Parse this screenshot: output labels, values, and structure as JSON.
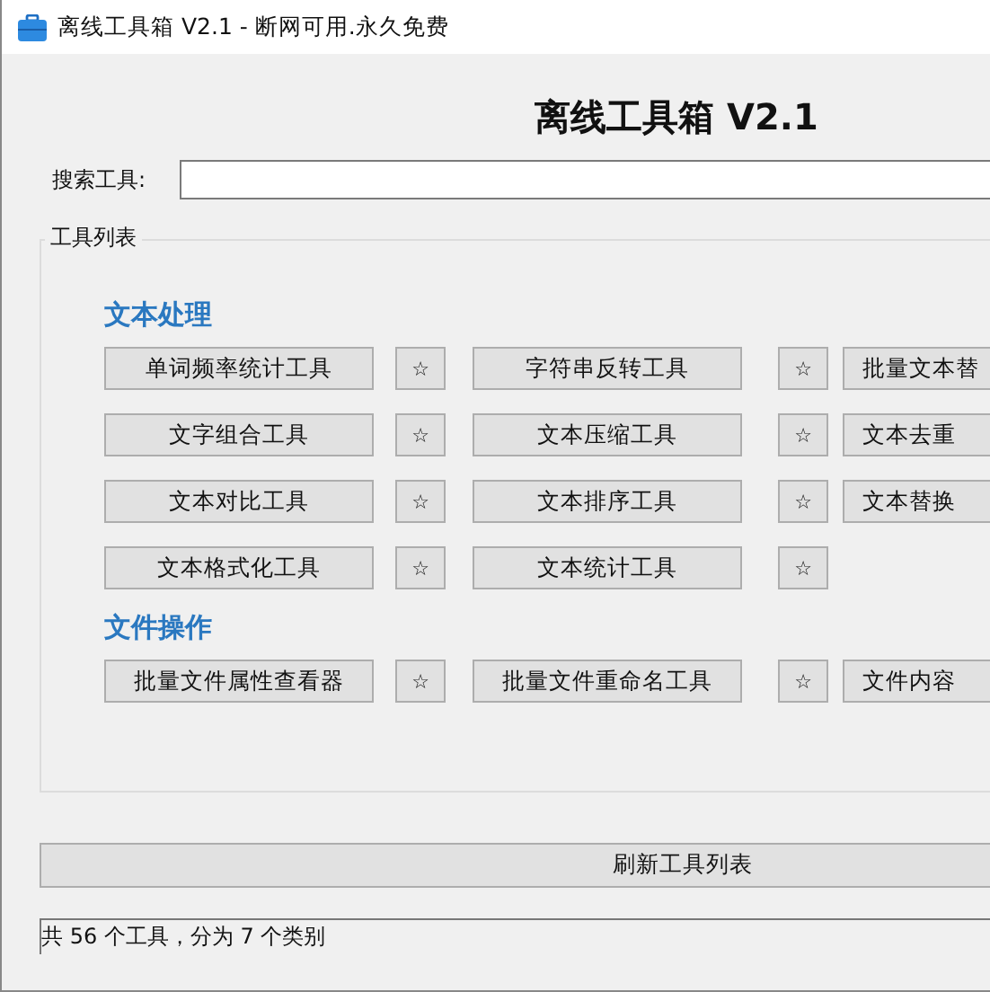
{
  "window": {
    "title": "离线工具箱 V2.1 - 断网可用.永久免费"
  },
  "heading": "离线工具箱 V2.1",
  "search": {
    "label": "搜索工具:"
  },
  "tool_list": {
    "title": "工具列表",
    "categories": [
      {
        "name": "文本处理",
        "tools": [
          {
            "label": "单词频率统计工具",
            "star": "☆"
          },
          {
            "label": "字符串反转工具",
            "star": "☆"
          },
          {
            "label": "批量文本替"
          },
          {
            "label": "文字组合工具",
            "star": "☆"
          },
          {
            "label": "文本压缩工具",
            "star": "☆"
          },
          {
            "label": "文本去重"
          },
          {
            "label": "文本对比工具",
            "star": "☆"
          },
          {
            "label": "文本排序工具",
            "star": "☆"
          },
          {
            "label": "文本替换"
          },
          {
            "label": "文本格式化工具",
            "star": "☆"
          },
          {
            "label": "文本统计工具",
            "star": "☆"
          }
        ]
      },
      {
        "name": "文件操作",
        "tools": [
          {
            "label": "批量文件属性查看器",
            "star": "☆"
          },
          {
            "label": "批量文件重命名工具",
            "star": "☆"
          },
          {
            "label": "文件内容"
          }
        ]
      }
    ]
  },
  "refresh_button": "刷新工具列表",
  "status_bar": "共 56 个工具，分为 7 个类别"
}
